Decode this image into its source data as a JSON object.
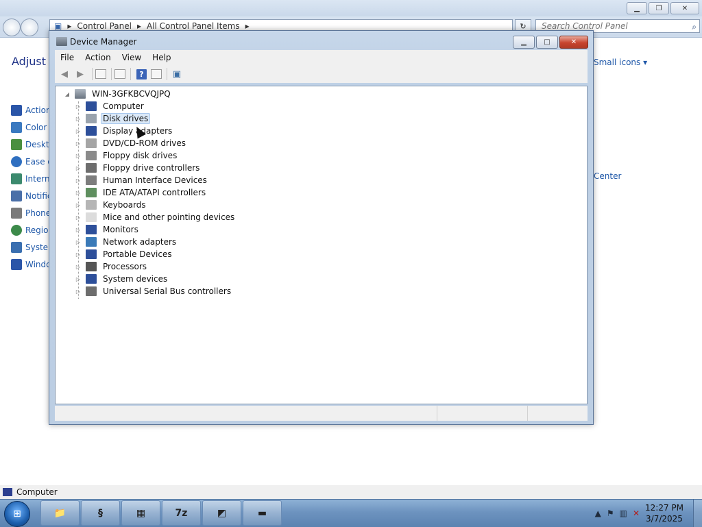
{
  "control_panel": {
    "breadcrumb": [
      "Control Panel",
      "All Control Panel Items"
    ],
    "search_placeholder": "Search Control Panel",
    "heading": "Adjust y",
    "view_by": "Small icons",
    "left_items": [
      "Action",
      "Color",
      "Deskto",
      "Ease o",
      "Interne",
      "Notific",
      "Phone",
      "Regior",
      "System",
      "Windo"
    ],
    "right_item": "Center",
    "status_text": "Computer"
  },
  "device_manager": {
    "title": "Device Manager",
    "menu": [
      "File",
      "Action",
      "View",
      "Help"
    ],
    "root": "WIN-3GFKBCVQJPQ",
    "selected": "Disk drives",
    "categories": [
      {
        "label": "Computer",
        "icon": "computer-icon",
        "color": "#2d4f9a"
      },
      {
        "label": "Disk drives",
        "icon": "disk-drive-icon",
        "color": "#9aa3ad"
      },
      {
        "label": "Display adapters",
        "icon": "display-adapter-icon",
        "color": "#2d4f9a"
      },
      {
        "label": "DVD/CD-ROM drives",
        "icon": "dvd-drive-icon",
        "color": "#a5a5a5"
      },
      {
        "label": "Floppy disk drives",
        "icon": "floppy-disk-icon",
        "color": "#8a8a8a"
      },
      {
        "label": "Floppy drive controllers",
        "icon": "floppy-controller-icon",
        "color": "#6d6d6d"
      },
      {
        "label": "Human Interface Devices",
        "icon": "hid-icon",
        "color": "#7d7d7d"
      },
      {
        "label": "IDE ATA/ATAPI controllers",
        "icon": "ide-controller-icon",
        "color": "#5f8f5f"
      },
      {
        "label": "Keyboards",
        "icon": "keyboard-icon",
        "color": "#b5b5b5"
      },
      {
        "label": "Mice and other pointing devices",
        "icon": "mouse-icon",
        "color": "#dcdcdc"
      },
      {
        "label": "Monitors",
        "icon": "monitor-icon",
        "color": "#2d4f9a"
      },
      {
        "label": "Network adapters",
        "icon": "network-adapter-icon",
        "color": "#3a7ab8"
      },
      {
        "label": "Portable Devices",
        "icon": "portable-device-icon",
        "color": "#2d4f9a"
      },
      {
        "label": "Processors",
        "icon": "processor-icon",
        "color": "#555555"
      },
      {
        "label": "System devices",
        "icon": "system-device-icon",
        "color": "#2d4f9a"
      },
      {
        "label": "Universal Serial Bus controllers",
        "icon": "usb-icon",
        "color": "#6d6d6d"
      }
    ]
  },
  "taskbar": {
    "apps": [
      {
        "name": "explorer-taskbar-button",
        "glyph": "📁"
      },
      {
        "name": "app-taskbar-button-2",
        "glyph": "§"
      },
      {
        "name": "control-panel-taskbar-button",
        "glyph": "▦"
      },
      {
        "name": "7zip-taskbar-button",
        "glyph": "7z"
      },
      {
        "name": "app-taskbar-button-5",
        "glyph": "◩"
      },
      {
        "name": "toolbox-taskbar-button",
        "glyph": "▬"
      }
    ],
    "time": "12:27 PM",
    "date": "3/7/2025"
  }
}
